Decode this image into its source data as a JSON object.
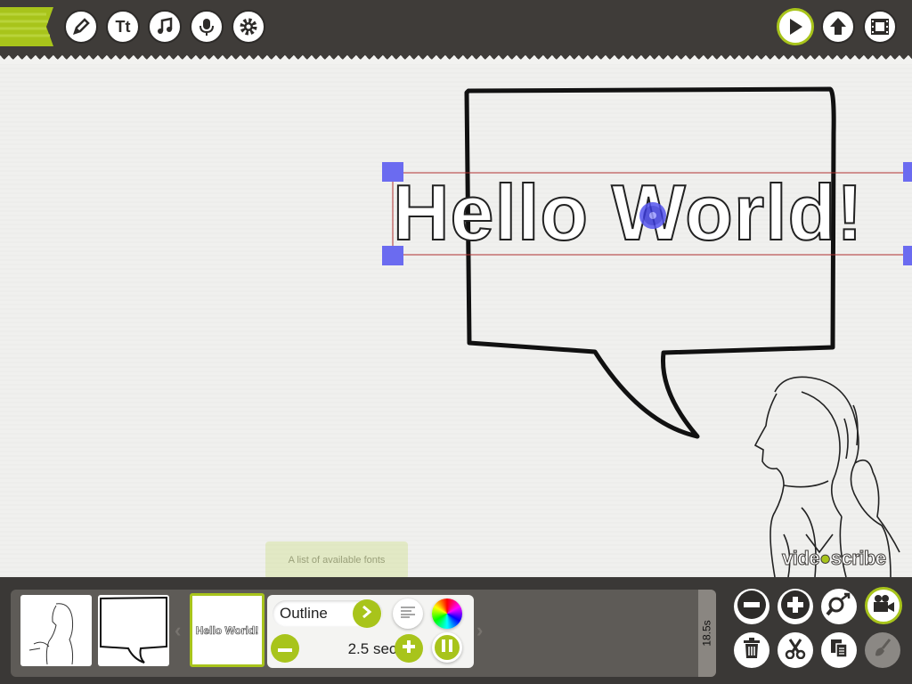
{
  "toolbar": {
    "left_icons": [
      "pencil-icon",
      "text-icon",
      "music-note-icon",
      "microphone-icon",
      "gear-icon"
    ],
    "text_tool_label": "Tt",
    "right_icons": [
      "play-icon",
      "upload-icon",
      "film-icon"
    ],
    "accent_color": "#a8c41b"
  },
  "canvas": {
    "text_element": "Hello World!",
    "brand_pre": "vide",
    "brand_post": "scribe",
    "tooltip": "A list of available fonts"
  },
  "timeline": {
    "selected_thumb_text": "Hello World!",
    "font_name": "Outline",
    "draw_duration": "2.5 sec",
    "total_duration": "18.5s"
  },
  "right_panel": {
    "icons": [
      "zoom-out-icon",
      "zoom-in-icon",
      "zoom-fit-icon",
      "camera-icon",
      "trash-icon",
      "scissors-icon",
      "copy-icon",
      "brush-icon"
    ]
  }
}
